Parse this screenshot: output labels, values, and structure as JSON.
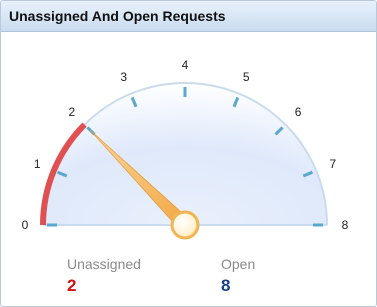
{
  "panel": {
    "title": "Unassigned And Open Requests"
  },
  "chart_data": {
    "type": "gauge",
    "range": [
      0,
      8
    ],
    "ticks": [
      "0",
      "1",
      "2",
      "3",
      "4",
      "5",
      "6",
      "7",
      "8"
    ],
    "value": 2,
    "needle_value": 2,
    "band_color": "#e05050",
    "needle_color": "#f2a640",
    "metrics": [
      {
        "label": "Unassigned",
        "value": "2",
        "color": "#d01010"
      },
      {
        "label": "Open",
        "value": "8",
        "color": "#1a3f8f"
      }
    ]
  }
}
